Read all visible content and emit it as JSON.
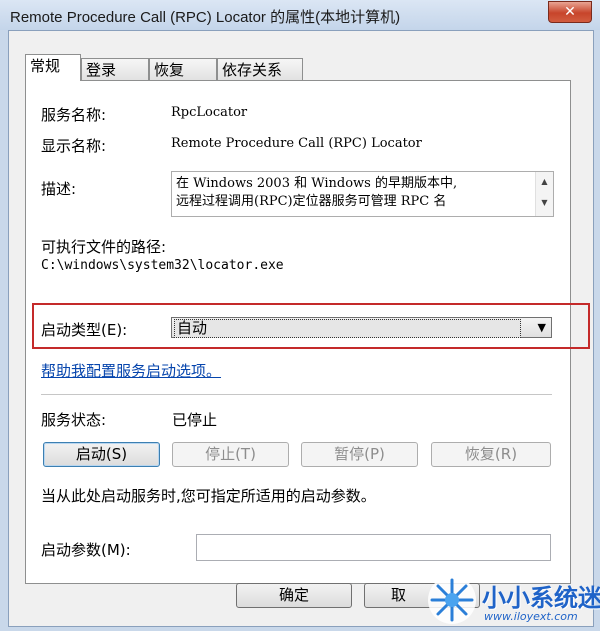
{
  "window": {
    "title": "Remote Procedure Call (RPC) Locator 的属性(本地计算机)",
    "close_label": "✕"
  },
  "tabs": [
    {
      "label": "常规",
      "active": true
    },
    {
      "label": "登录",
      "active": false
    },
    {
      "label": "恢复",
      "active": false
    },
    {
      "label": "依存关系",
      "active": false
    }
  ],
  "general": {
    "service_name_label": "服务名称:",
    "service_name": "RpcLocator",
    "display_name_label": "显示名称:",
    "display_name": "Remote Procedure Call (RPC) Locator",
    "description_label": "描述:",
    "description_line1": "在 Windows 2003 和 Windows 的早期版本中,",
    "description_line2": "远程过程调用(RPC)定位器服务可管理 RPC 名",
    "exe_path_label": "可执行文件的路径:",
    "exe_path": "C:\\windows\\system32\\locator.exe",
    "startup_type_label": "启动类型(E):",
    "startup_type_value": "自动",
    "help_link": "帮助我配置服务启动选项。",
    "status_label": "服务状态:",
    "status_value": "已停止",
    "start_button": "启动(S)",
    "stop_button": "停止(T)",
    "pause_button": "暂停(P)",
    "resume_button": "恢复(R)",
    "start_params_hint": "当从此处启动服务时,您可指定所适用的启动参数。",
    "start_params_label": "启动参数(M):",
    "start_params_value": ""
  },
  "footer": {
    "ok_button": "确定",
    "cancel_button": "取"
  },
  "watermark": {
    "title": "小小系统迷",
    "url": "www.iloyext.com"
  },
  "colors": {
    "highlight_border": "#c42a2a",
    "link": "#0645ad",
    "watermark": "#1f63c8"
  }
}
